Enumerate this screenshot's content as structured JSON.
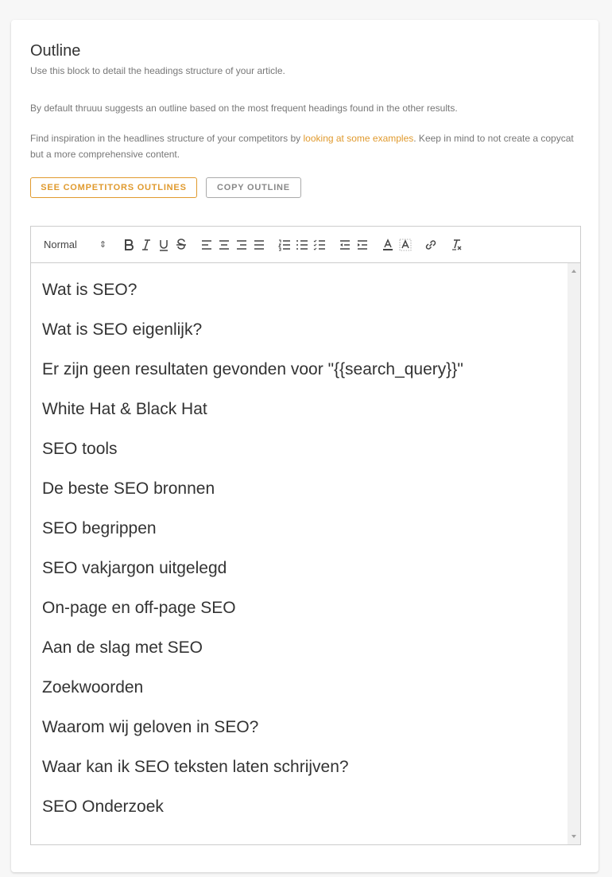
{
  "outline": {
    "title": "Outline",
    "subtitle": "Use this block to detail the headings structure of your article.",
    "paragraph1": "By default thruuu suggests an outline based on the most frequent headings found in the other results.",
    "paragraph2_before": "Find inspiration in the headlines structure of your competitors by ",
    "paragraph2_link": "looking at some examples",
    "paragraph2_after": ". Keep in mind to not create a copycat but a more comprehensive content.",
    "buttons": {
      "see_competitors": "SEE COMPETITORS OUTLINES",
      "copy_outline": "COPY OUTLINE"
    }
  },
  "toolbar": {
    "format_select": "Normal",
    "icons": [
      "bold-icon",
      "italic-icon",
      "underline-icon",
      "strikethrough-icon",
      "align-left-icon",
      "align-center-icon",
      "align-right-icon",
      "align-justify-icon",
      "ordered-list-icon",
      "bullet-list-icon",
      "checklist-icon",
      "outdent-icon",
      "indent-icon",
      "text-color-icon",
      "background-color-icon",
      "link-icon",
      "clear-format-icon"
    ]
  },
  "headings": [
    "Wat is SEO?",
    "Wat is SEO eigenlijk?",
    "Er zijn geen resultaten gevonden voor \"{{search_query}}\"",
    "White Hat & Black Hat",
    "SEO tools",
    "De beste SEO bronnen",
    "SEO begrippen",
    "SEO vakjargon uitgelegd",
    "On-page en off-page SEO",
    "Aan de slag met SEO",
    "Zoekwoorden",
    "Waarom wij geloven in SEO?",
    "Waar kan ik SEO teksten laten schrijven?",
    "SEO Onderzoek"
  ],
  "colors": {
    "accent": "#e09a2e",
    "text": "#333333",
    "muted": "#777777"
  }
}
